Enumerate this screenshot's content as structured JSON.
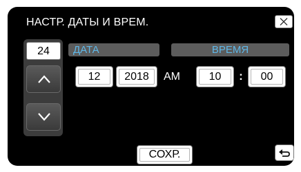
{
  "header": {
    "title": "НАСТР. ДАТЫ И ВРЕМ.",
    "close_icon": "close-icon"
  },
  "date_time": {
    "day": "24",
    "month": "12",
    "year": "2018",
    "meridiem": "AM",
    "hour": "10",
    "minute": "00",
    "separator": ":"
  },
  "tabs": {
    "date_label": "ДАТА",
    "time_label": "ВРЕМЯ"
  },
  "controls": {
    "up_icon": "chevron-up-icon",
    "down_icon": "chevron-down-icon",
    "back_icon": "back-icon"
  },
  "footer": {
    "save_label": "СОХР."
  },
  "colors": {
    "background": "#000000",
    "tab_text": "#5fb8e8",
    "tab_bg": "#5c5c5c"
  }
}
